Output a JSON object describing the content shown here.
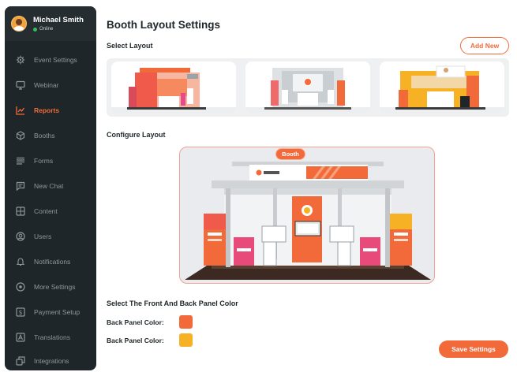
{
  "profile": {
    "name": "Michael Smith",
    "status": "Online"
  },
  "nav": [
    {
      "label": "Event Settings",
      "icon": "gear-icon",
      "active": false
    },
    {
      "label": "Webinar",
      "icon": "monitor-icon",
      "active": false
    },
    {
      "label": "Reports",
      "icon": "chart-icon",
      "active": true
    },
    {
      "label": "Booths",
      "icon": "cube-icon",
      "active": false
    },
    {
      "label": "Forms",
      "icon": "list-icon",
      "active": false
    },
    {
      "label": "New Chat",
      "icon": "chat-icon",
      "active": false
    },
    {
      "label": "Content",
      "icon": "image-icon",
      "active": false
    },
    {
      "label": "Users",
      "icon": "user-icon",
      "active": false
    },
    {
      "label": "Notifications",
      "icon": "bell-icon",
      "active": false
    },
    {
      "label": "More Settings",
      "icon": "settings-circle-icon",
      "active": false
    },
    {
      "label": "Payment Setup",
      "icon": "dollar-icon",
      "active": false
    },
    {
      "label": "Translations",
      "icon": "translate-icon",
      "active": false
    },
    {
      "label": "Integrations",
      "icon": "integrations-icon",
      "active": false
    }
  ],
  "main": {
    "title": "Booth Layout Settings",
    "select_layout_label": "Select Layout",
    "add_new_label": "Add New",
    "configure_label": "Configure Layout",
    "booth_tag": "Booth",
    "panel_color_heading": "Select The Front And Back Panel Color",
    "panel_colors": [
      {
        "label": "Back Panel Color:",
        "color": "#f26a3a"
      },
      {
        "label": "Back Panel Color:",
        "color": "#f7b125"
      }
    ],
    "save_label": "Save Settings"
  },
  "colors": {
    "accent": "#f26a3a",
    "sidebar": "#1f2629",
    "active_nav": "#f26a3a",
    "online": "#2fbf5b"
  }
}
